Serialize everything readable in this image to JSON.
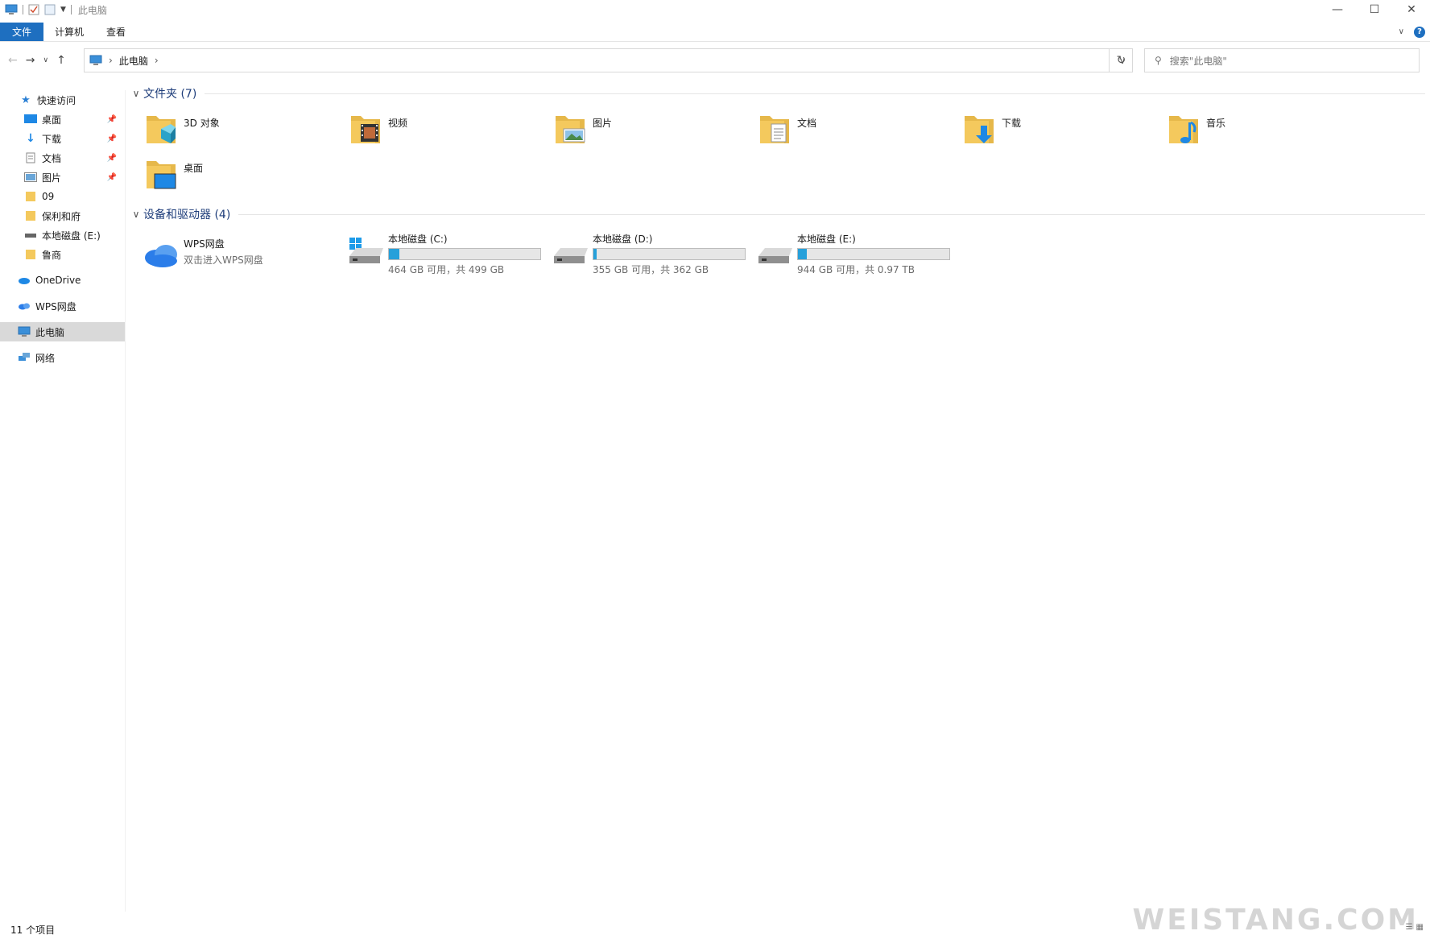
{
  "window": {
    "title": "此电脑"
  },
  "ribbon": {
    "tabs": [
      "文件",
      "计算机",
      "查看"
    ]
  },
  "address": {
    "crumb": "此电脑",
    "search_placeholder": "搜索\"此电脑\""
  },
  "sidebar": {
    "quick_access": "快速访问",
    "items": [
      {
        "label": "桌面",
        "pinned": true
      },
      {
        "label": "下载",
        "pinned": true
      },
      {
        "label": "文档",
        "pinned": true
      },
      {
        "label": "图片",
        "pinned": true
      },
      {
        "label": "09",
        "pinned": false
      },
      {
        "label": "保利和府",
        "pinned": false
      },
      {
        "label": "本地磁盘 (E:)",
        "pinned": false
      },
      {
        "label": "鲁商",
        "pinned": false
      }
    ],
    "onedrive": "OneDrive",
    "wps": "WPS网盘",
    "this_pc": "此电脑",
    "network": "网络"
  },
  "folders_group": {
    "label": "文件夹 (7)"
  },
  "folders": [
    {
      "label": "3D 对象",
      "icon": "3d-objects-icon"
    },
    {
      "label": "视频",
      "icon": "video-icon"
    },
    {
      "label": "图片",
      "icon": "pictures-icon"
    },
    {
      "label": "文档",
      "icon": "documents-icon"
    },
    {
      "label": "下载",
      "icon": "downloads-icon"
    },
    {
      "label": "音乐",
      "icon": "music-icon"
    },
    {
      "label": "桌面",
      "icon": "desktop-icon"
    }
  ],
  "devices_group": {
    "label": "设备和驱动器 (4)"
  },
  "wps_drive": {
    "name": "WPS网盘",
    "sub": "双击进入WPS网盘"
  },
  "drives": [
    {
      "name": "本地磁盘 (C:)",
      "free": "464 GB 可用，共 499 GB",
      "used_fraction": 0.07,
      "windows": true
    },
    {
      "name": "本地磁盘 (D:)",
      "free": "355 GB 可用，共 362 GB",
      "used_fraction": 0.02,
      "windows": false
    },
    {
      "name": "本地磁盘 (E:)",
      "free": "944 GB 可用，共 0.97 TB",
      "used_fraction": 0.06,
      "windows": false
    }
  ],
  "status": {
    "count": "11 个项目"
  },
  "watermark": "WEISTANG.COM",
  "colors": {
    "accent": "#1e6fc0",
    "bar_fill": "#26a0da",
    "folder": "#f4c95d"
  }
}
